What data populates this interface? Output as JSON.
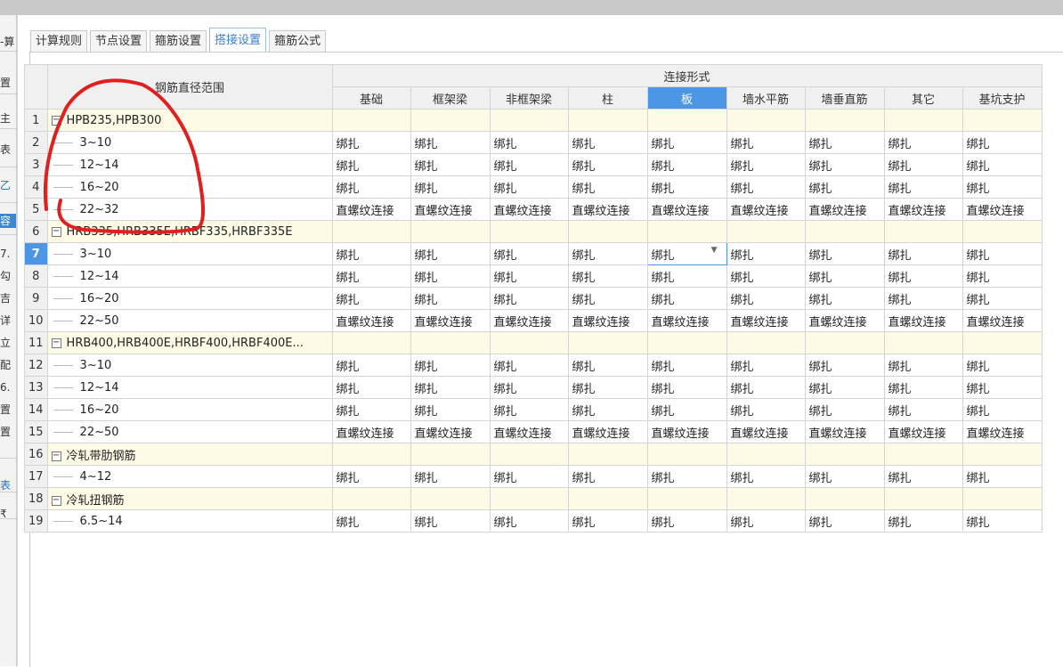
{
  "left_strip": {
    "items": [
      "-算",
      "置",
      "主",
      "表",
      "乙",
      "容",
      "7.",
      "勾",
      "吉",
      "详",
      "立",
      "配",
      "6.",
      "置",
      "置",
      "表",
      "₹"
    ]
  },
  "tabs": [
    {
      "label": "计算规则",
      "active": false
    },
    {
      "label": "节点设置",
      "active": false
    },
    {
      "label": "箍筋设置",
      "active": false
    },
    {
      "label": "搭接设置",
      "active": true
    },
    {
      "label": "箍筋公式",
      "active": false
    }
  ],
  "table": {
    "range_header": "钢筋直径范围",
    "group_header": "连接形式",
    "columns": [
      "基础",
      "框架梁",
      "非框架梁",
      "柱",
      "板",
      "墙水平筋",
      "墙垂直筋",
      "其它",
      "基坑支护"
    ],
    "selected_column": 4,
    "selected_row": 7,
    "rows": [
      {
        "num": "1",
        "label": "HPB235,HPB300",
        "group": true,
        "cells": []
      },
      {
        "num": "2",
        "label": "3~10",
        "group": false,
        "cells": [
          "绑扎",
          "绑扎",
          "绑扎",
          "绑扎",
          "绑扎",
          "绑扎",
          "绑扎",
          "绑扎",
          "绑扎"
        ]
      },
      {
        "num": "3",
        "label": "12~14",
        "group": false,
        "cells": [
          "绑扎",
          "绑扎",
          "绑扎",
          "绑扎",
          "绑扎",
          "绑扎",
          "绑扎",
          "绑扎",
          "绑扎"
        ]
      },
      {
        "num": "4",
        "label": "16~20",
        "group": false,
        "cells": [
          "绑扎",
          "绑扎",
          "绑扎",
          "绑扎",
          "绑扎",
          "绑扎",
          "绑扎",
          "绑扎",
          "绑扎"
        ]
      },
      {
        "num": "5",
        "label": "22~32",
        "group": false,
        "cells": [
          "直螺纹连接",
          "直螺纹连接",
          "直螺纹连接",
          "直螺纹连接",
          "直螺纹连接",
          "直螺纹连接",
          "直螺纹连接",
          "直螺纹连接",
          "直螺纹连接"
        ]
      },
      {
        "num": "6",
        "label": "HRB335,HRB335E,HRBF335,HRBF335E",
        "group": true,
        "cells": []
      },
      {
        "num": "7",
        "label": "3~10",
        "group": false,
        "cells": [
          "绑扎",
          "绑扎",
          "绑扎",
          "绑扎",
          "绑扎",
          "绑扎",
          "绑扎",
          "绑扎",
          "绑扎"
        ]
      },
      {
        "num": "8",
        "label": "12~14",
        "group": false,
        "cells": [
          "绑扎",
          "绑扎",
          "绑扎",
          "绑扎",
          "绑扎",
          "绑扎",
          "绑扎",
          "绑扎",
          "绑扎"
        ]
      },
      {
        "num": "9",
        "label": "16~20",
        "group": false,
        "cells": [
          "绑扎",
          "绑扎",
          "绑扎",
          "绑扎",
          "绑扎",
          "绑扎",
          "绑扎",
          "绑扎",
          "绑扎"
        ]
      },
      {
        "num": "10",
        "label": "22~50",
        "group": false,
        "cells": [
          "直螺纹连接",
          "直螺纹连接",
          "直螺纹连接",
          "直螺纹连接",
          "直螺纹连接",
          "直螺纹连接",
          "直螺纹连接",
          "直螺纹连接",
          "直螺纹连接"
        ]
      },
      {
        "num": "11",
        "label": "HRB400,HRB400E,HRBF400,HRBF400E...",
        "group": true,
        "cells": []
      },
      {
        "num": "12",
        "label": "3~10",
        "group": false,
        "cells": [
          "绑扎",
          "绑扎",
          "绑扎",
          "绑扎",
          "绑扎",
          "绑扎",
          "绑扎",
          "绑扎",
          "绑扎"
        ]
      },
      {
        "num": "13",
        "label": "12~14",
        "group": false,
        "cells": [
          "绑扎",
          "绑扎",
          "绑扎",
          "绑扎",
          "绑扎",
          "绑扎",
          "绑扎",
          "绑扎",
          "绑扎"
        ]
      },
      {
        "num": "14",
        "label": "16~20",
        "group": false,
        "cells": [
          "绑扎",
          "绑扎",
          "绑扎",
          "绑扎",
          "绑扎",
          "绑扎",
          "绑扎",
          "绑扎",
          "绑扎"
        ]
      },
      {
        "num": "15",
        "label": "22~50",
        "group": false,
        "cells": [
          "直螺纹连接",
          "直螺纹连接",
          "直螺纹连接",
          "直螺纹连接",
          "直螺纹连接",
          "直螺纹连接",
          "直螺纹连接",
          "直螺纹连接",
          "直螺纹连接"
        ]
      },
      {
        "num": "16",
        "label": "冷轧带肋钢筋",
        "group": true,
        "cells": []
      },
      {
        "num": "17",
        "label": "4~12",
        "group": false,
        "cells": [
          "绑扎",
          "绑扎",
          "绑扎",
          "绑扎",
          "绑扎",
          "绑扎",
          "绑扎",
          "绑扎",
          "绑扎"
        ]
      },
      {
        "num": "18",
        "label": "冷轧扭钢筋",
        "group": true,
        "cells": []
      },
      {
        "num": "19",
        "label": "6.5~14",
        "group": false,
        "cells": [
          "绑扎",
          "绑扎",
          "绑扎",
          "绑扎",
          "绑扎",
          "绑扎",
          "绑扎",
          "绑扎",
          "绑扎"
        ]
      }
    ]
  },
  "colors": {
    "accent": "#4d96e6",
    "group_row_bg": "#fdfbe6",
    "annotation": "#e02020"
  }
}
